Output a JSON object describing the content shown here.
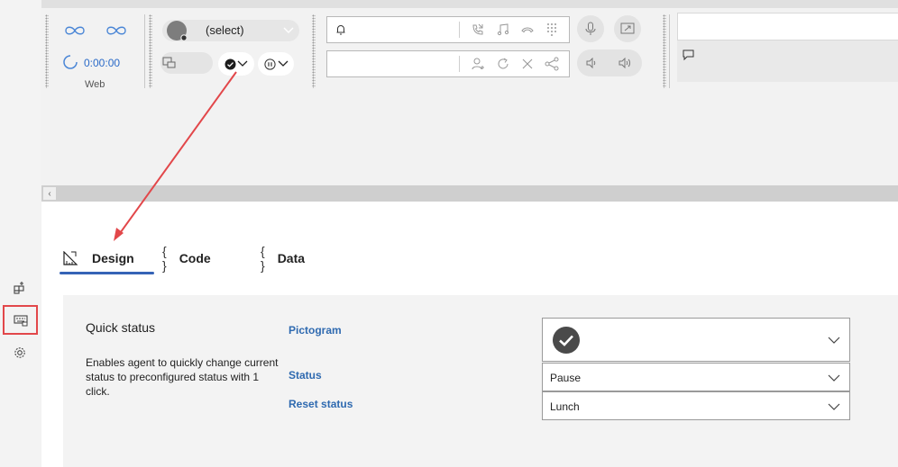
{
  "toolbar": {
    "timer": "0:00:00",
    "channel_label": "Web",
    "status_select": "(select)"
  },
  "tabs": [
    {
      "label": "Design",
      "icon": "ruler-triangle-icon",
      "selected": true
    },
    {
      "label": "Code",
      "icon": "braces-icon",
      "selected": false
    },
    {
      "label": "Data",
      "icon": "braces-icon",
      "selected": false
    }
  ],
  "properties": {
    "title": "Quick status",
    "description": "Enables agent to quickly change current status to preconfigured status with 1 click.",
    "pictogram_label": "Pictogram",
    "status_label": "Status",
    "reset_label": "Reset status",
    "status_value": "Pause",
    "reset_value": "Lunch",
    "pictogram_value_icon": "check-circle-icon"
  },
  "sidebar": {
    "items": [
      {
        "icon": "add-widget-icon",
        "selected": false
      },
      {
        "icon": "keyboard-widget-icon",
        "selected": true
      },
      {
        "icon": "gear-icon",
        "selected": false
      }
    ]
  },
  "colors": {
    "accent": "#3563b6",
    "label_blue": "#2f6ab0",
    "highlight_red": "#e2474a",
    "timer_blue": "#2a6ac8"
  }
}
